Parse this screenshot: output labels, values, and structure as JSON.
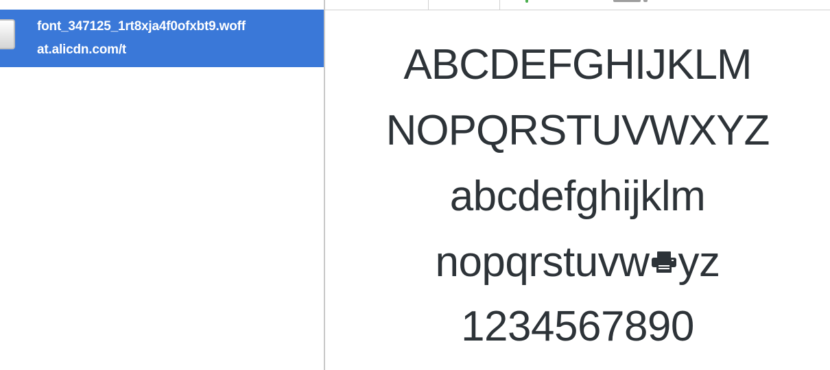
{
  "request": {
    "name": "font_347125_1rt8xja4f0ofxbt9.woff",
    "host": "at.alicdn.com/t"
  },
  "preview": {
    "line1": "ABCDEFGHIJKLM",
    "line2": "NOPQRSTUVWXYZ",
    "line3": "abcdefghijklm",
    "line4_before": "nopqrstuvw",
    "line4_icon": "printer-icon",
    "line4_after": "yz",
    "line5": "1234567890"
  },
  "colors": {
    "selection": "#3a78d8",
    "preview_text": "#2d3338"
  }
}
